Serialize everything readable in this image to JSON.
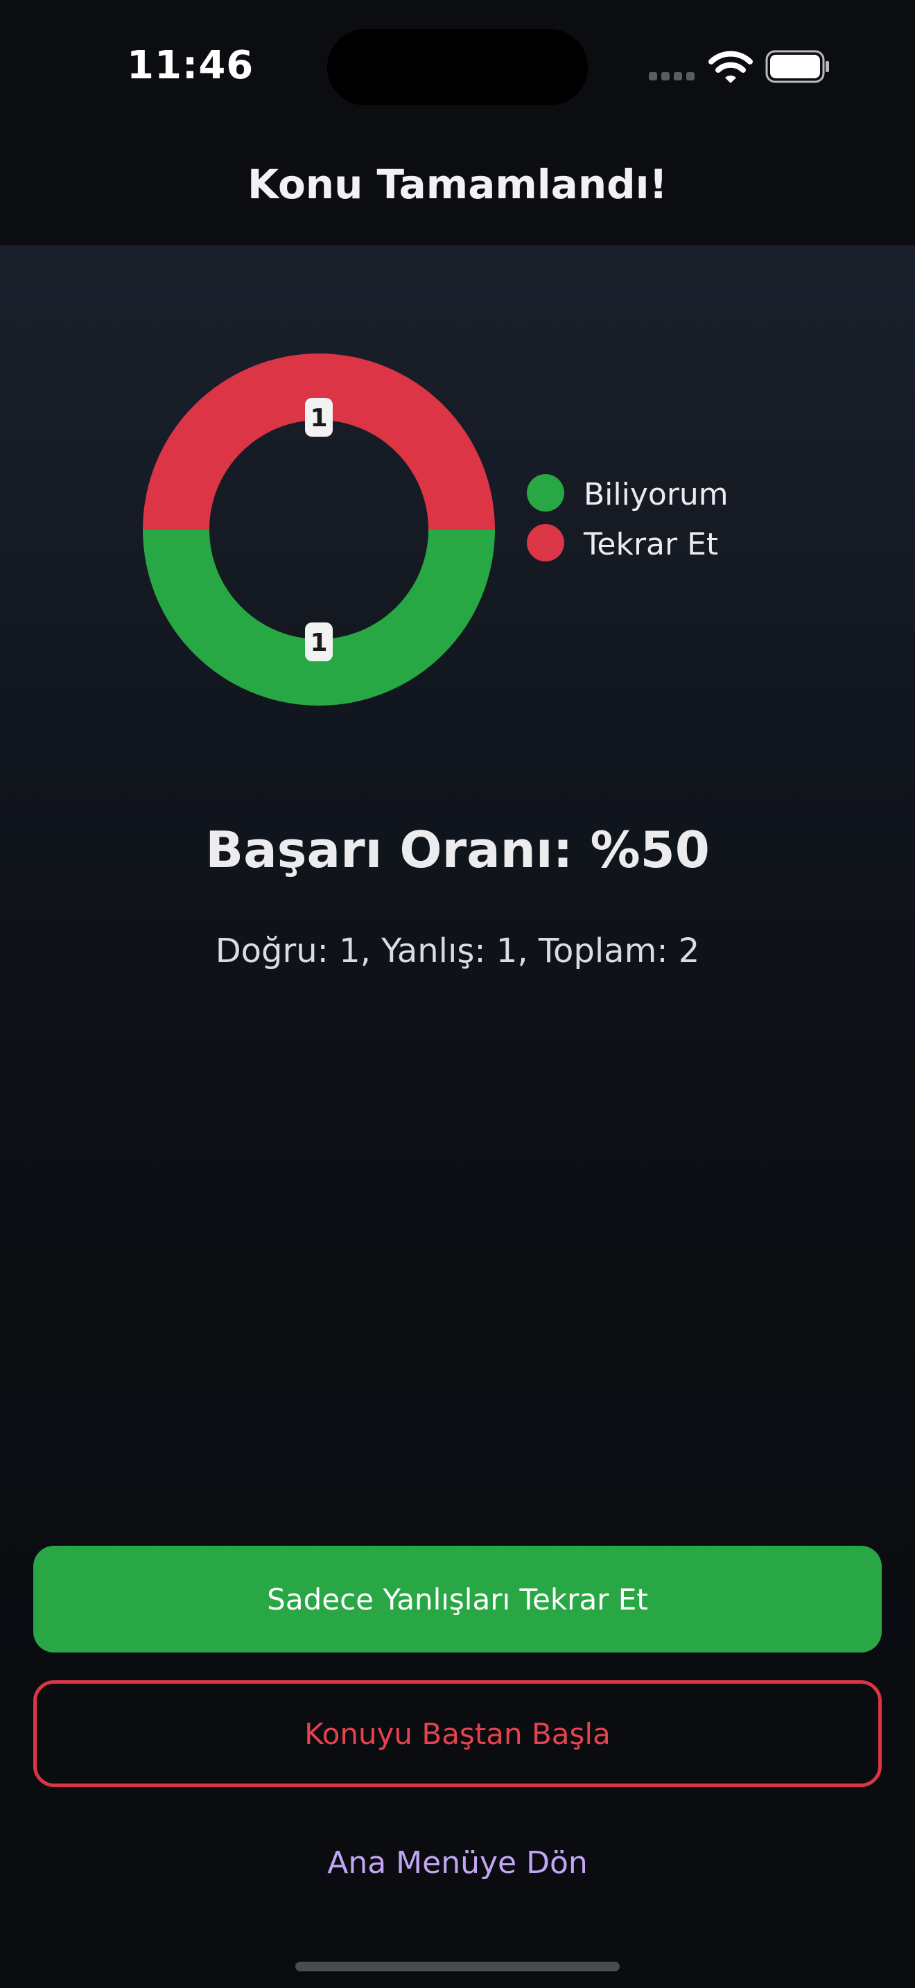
{
  "status_bar": {
    "time": "11:46"
  },
  "header": {
    "title": "Konu Tamamlandı!"
  },
  "chart_data": {
    "type": "pie",
    "style": "donut",
    "categories": [
      "Biliyorum",
      "Tekrar Et"
    ],
    "values": [
      1,
      1
    ],
    "colors": [
      "#28a745",
      "#dc3545"
    ],
    "legend_position": "right"
  },
  "results": {
    "success_rate": "Başarı Oranı: %50",
    "summary": "Doğru: 1, Yanlış: 1, Toplam: 2"
  },
  "actions": {
    "retry_wrong_label": "Sadece Yanlışları Tekrar Et",
    "restart_label": "Konuyu Baştan Başla",
    "home_label": "Ana Menüye Dön"
  },
  "colors": {
    "success": "#28a745",
    "danger": "#dc3545",
    "link": "#c3a5f5"
  }
}
